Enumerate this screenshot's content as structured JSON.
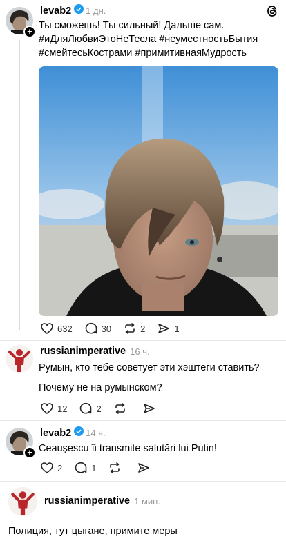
{
  "post": {
    "username": "levab2",
    "time": "1 дн.",
    "lines": [
      "Ты сможешь! Ты сильный! Дальше сам.",
      "#иДляЛюбвиЭтоНеТесла #неуместностьБытия",
      "#смейтесьКострами #примитивнаяМудрость"
    ],
    "likes": "632",
    "comments": "30",
    "reposts": "2",
    "shares": "1"
  },
  "reply1": {
    "username": "russianimperative",
    "time": "16 ч.",
    "line1": "Румын, кто тебе советует эти хэштеги ставить?",
    "line2": "Почему не на румынском?",
    "likes": "12",
    "comments": "2"
  },
  "reply2": {
    "username": "levab2",
    "time": "14 ч.",
    "text": "Ceaușescu îi transmite salutări lui Putin!",
    "likes": "2",
    "comments": "1"
  },
  "reply3": {
    "username": "russianimperative",
    "time": "1 мин.",
    "text": "Полиция, тут цыгане, примите меры"
  },
  "colors": {
    "verified": "#1d9bf0",
    "meta": "#9a9a9a",
    "avatar_red": "#b8262a"
  },
  "icons": [
    "threads-logo-icon",
    "verified-badge-icon",
    "heart-icon",
    "comment-icon",
    "repost-icon",
    "share-icon",
    "follow-plus-icon"
  ]
}
